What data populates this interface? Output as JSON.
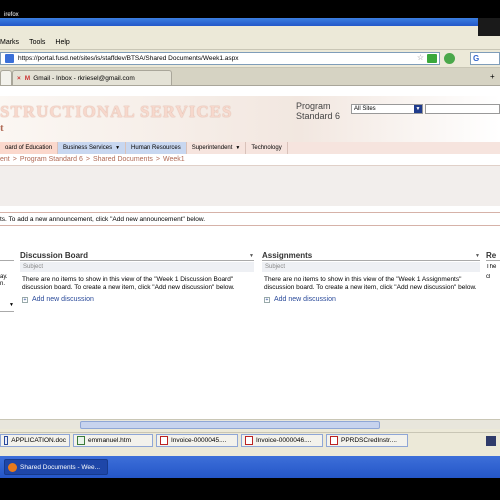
{
  "browser": {
    "title_fragment": "irefox",
    "menu": [
      "Marks",
      "Tools",
      "Help"
    ],
    "url": "https://portal.fusd.net/sites/is/staffdev/BTSA/Shared Documents/Week1.aspx",
    "tabs": [
      {
        "label": "Gmail - Inbox - rkriesel@gmail.com"
      }
    ]
  },
  "site": {
    "title": "STRUCTIONAL SERVICES",
    "subtitle": "t",
    "program_label": "Program Standard 6",
    "scope_select": "All Sites",
    "topnav": [
      {
        "label": "oard of Education"
      },
      {
        "label": "Business Services",
        "dropdown": true
      },
      {
        "label": "Human Resources"
      },
      {
        "label": "Superintendent",
        "dropdown": true
      },
      {
        "label": "Technology"
      }
    ],
    "breadcrumb": [
      "ent",
      "Program Standard 6",
      "Shared Documents",
      "Week1"
    ],
    "announcement": "ts. To add a new announcement, click \"Add new announcement\" below."
  },
  "webparts": {
    "left_stub": {
      "text": "ay. n."
    },
    "discussion": {
      "title": "Discussion Board",
      "column": "Subject",
      "message": "There are no items to show in this view of the \"Week 1 Discussion Board\" discussion board. To create a new item, click \"Add new discussion\" below.",
      "add_label": "Add new discussion"
    },
    "assignments": {
      "title": "Assignments",
      "column": "Subject",
      "message": "There are no items to show in this view of the \"Week 1 Assignments\" discussion board. To create a new item, click \"Add new discussion\" below.",
      "add_label": "Add new discussion"
    },
    "right_stub": {
      "title": "Re",
      "text": "The",
      "text2": "cl"
    }
  },
  "downloads": [
    {
      "label": "APPLICATION.doc",
      "type": "doc"
    },
    {
      "label": "emmanuel.htm",
      "type": "htm"
    },
    {
      "label": "Invoice-0000045....",
      "type": "pdf"
    },
    {
      "label": "Invoice-0000046....",
      "type": "pdf"
    },
    {
      "label": "PPRDSCredInstr....",
      "type": "pdf"
    }
  ],
  "taskbar": {
    "active_window": "Shared Documents - Wee..."
  }
}
